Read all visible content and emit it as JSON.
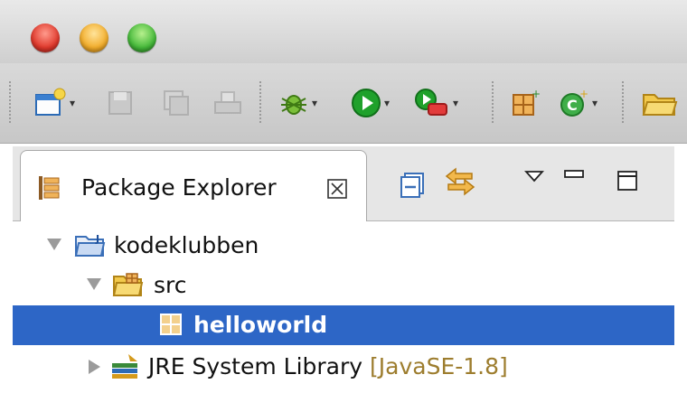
{
  "window": {
    "traffic_lights": [
      "close",
      "minimize",
      "zoom"
    ]
  },
  "toolbar": {
    "items": [
      {
        "icon": "new-wizard-icon",
        "dropdown": true
      },
      {
        "icon": "save-icon",
        "enabled": false
      },
      {
        "icon": "save-all-icon",
        "enabled": false
      },
      {
        "icon": "print-icon",
        "enabled": false
      },
      {
        "icon": "debug-icon",
        "dropdown": true
      },
      {
        "icon": "run-icon",
        "dropdown": true
      },
      {
        "icon": "run-external-tools-icon",
        "dropdown": true
      },
      {
        "icon": "new-package-icon"
      },
      {
        "icon": "new-class-icon",
        "dropdown": true
      },
      {
        "icon": "open-folder-icon"
      }
    ],
    "dropdown_glyph": "▾"
  },
  "package_explorer": {
    "tab_label": "Package Explorer",
    "tab_close_glyph": "☒",
    "tree": [
      {
        "label": "kodeklubben",
        "expanded": true,
        "icon": "java-project-icon"
      },
      {
        "label": "src",
        "expanded": true,
        "icon": "source-folder-icon"
      },
      {
        "label": "helloworld",
        "selected": true,
        "icon": "package-icon"
      },
      {
        "label": "JRE System Library",
        "decoration": "[JavaSE-1.8]",
        "expanded": false,
        "icon": "library-icon"
      }
    ]
  },
  "colors": {
    "selection": "#2d66c6",
    "decoration": "#9d7d2e",
    "run_green": "#1fa12b",
    "folder_yellow": "#f2c94c"
  }
}
